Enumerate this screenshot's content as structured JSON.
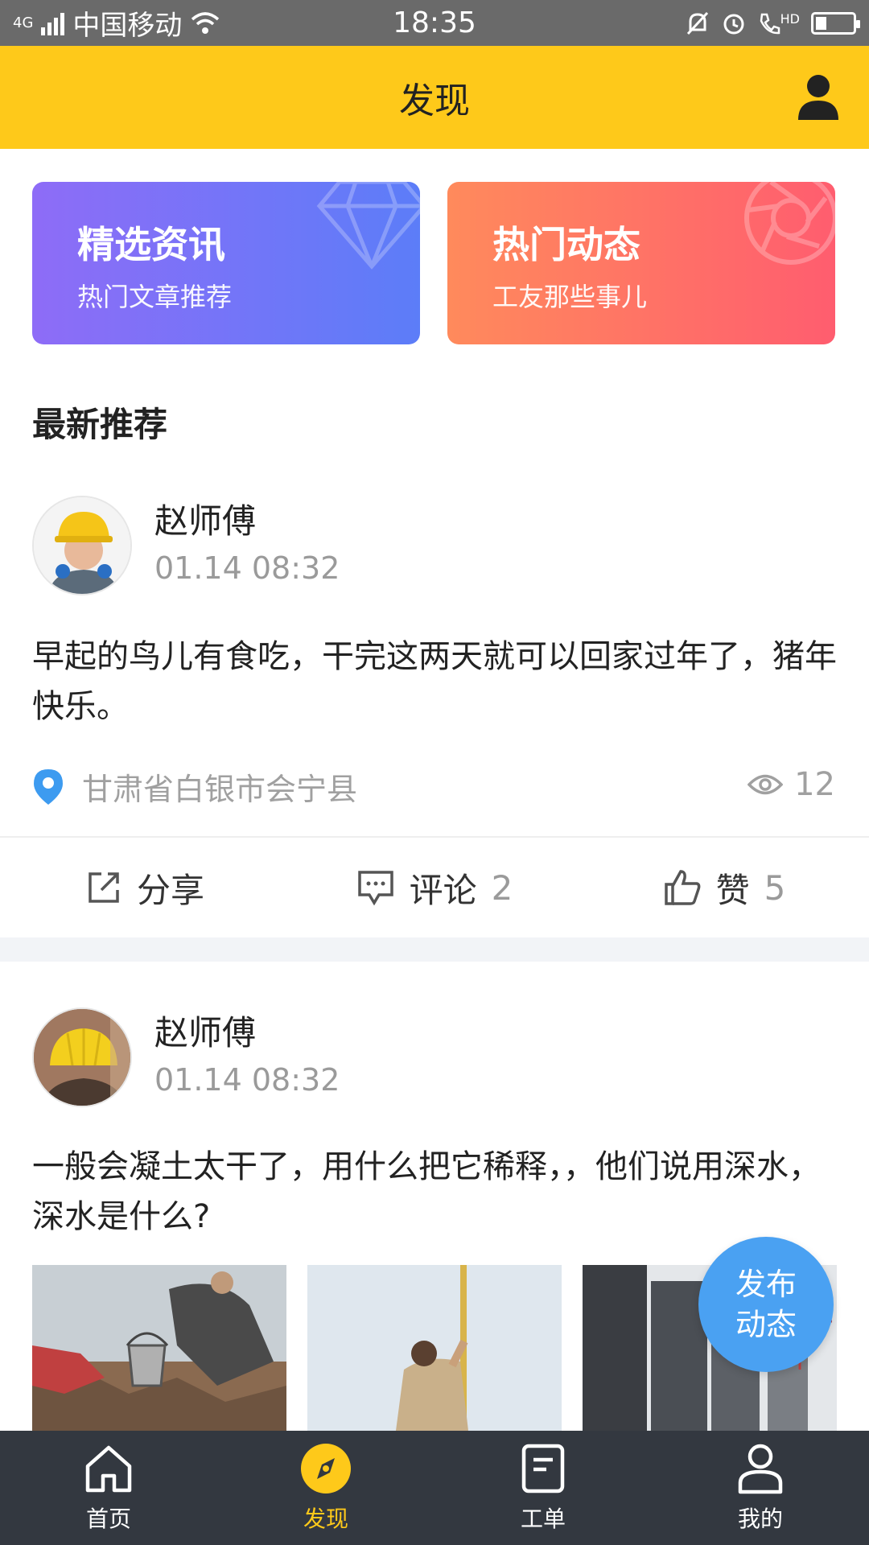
{
  "status_bar": {
    "network": "4G",
    "carrier": "中国移动",
    "time": "18:35",
    "hd": "HD",
    "battery_level": 0.3,
    "icons": [
      "signal-icon",
      "wifi-icon",
      "mute-bell-icon",
      "alarm-icon",
      "hd-call-icon",
      "battery-icon"
    ]
  },
  "header": {
    "title": "发现",
    "user_icon": "user-icon"
  },
  "categories": [
    {
      "title": "精选资讯",
      "subtitle": "热门文章推荐",
      "icon": "diamond-icon",
      "colors": [
        "#8e6cf7",
        "#5c7df8"
      ]
    },
    {
      "title": "热门动态",
      "subtitle": "工友那些事儿",
      "icon": "aperture-icon",
      "colors": [
        "#ff8a5c",
        "#ff5d6f"
      ]
    }
  ],
  "section_title": "最新推荐",
  "posts": [
    {
      "author": "赵师傅",
      "time": "01.14  08:32",
      "text": "早起的鸟儿有食吃，干完这两天就可以回家过年了，猪年快乐。",
      "location": "甘肃省白银市会宁县",
      "views": "12",
      "actions": {
        "share": "分享",
        "comment": "评论",
        "comment_count": "2",
        "like": "赞",
        "like_count": "5"
      }
    },
    {
      "author": "赵师傅",
      "time": "01.14  08:32",
      "text": "一般会凝土太干了，用什么把它稀释，，他们说用深水，深水是什么?"
    }
  ],
  "fab": {
    "line1": "发布",
    "line2": "动态"
  },
  "tabs": [
    {
      "label": "首页",
      "icon": "home-icon"
    },
    {
      "label": "发现",
      "icon": "compass-icon",
      "active": true
    },
    {
      "label": "工单",
      "icon": "document-icon"
    },
    {
      "label": "我的",
      "icon": "profile-icon"
    }
  ],
  "colors": {
    "accent": "#fec91a",
    "tabbar": "#333840",
    "fab": "#4aa1f2",
    "location_pin": "#3d9bf0"
  }
}
